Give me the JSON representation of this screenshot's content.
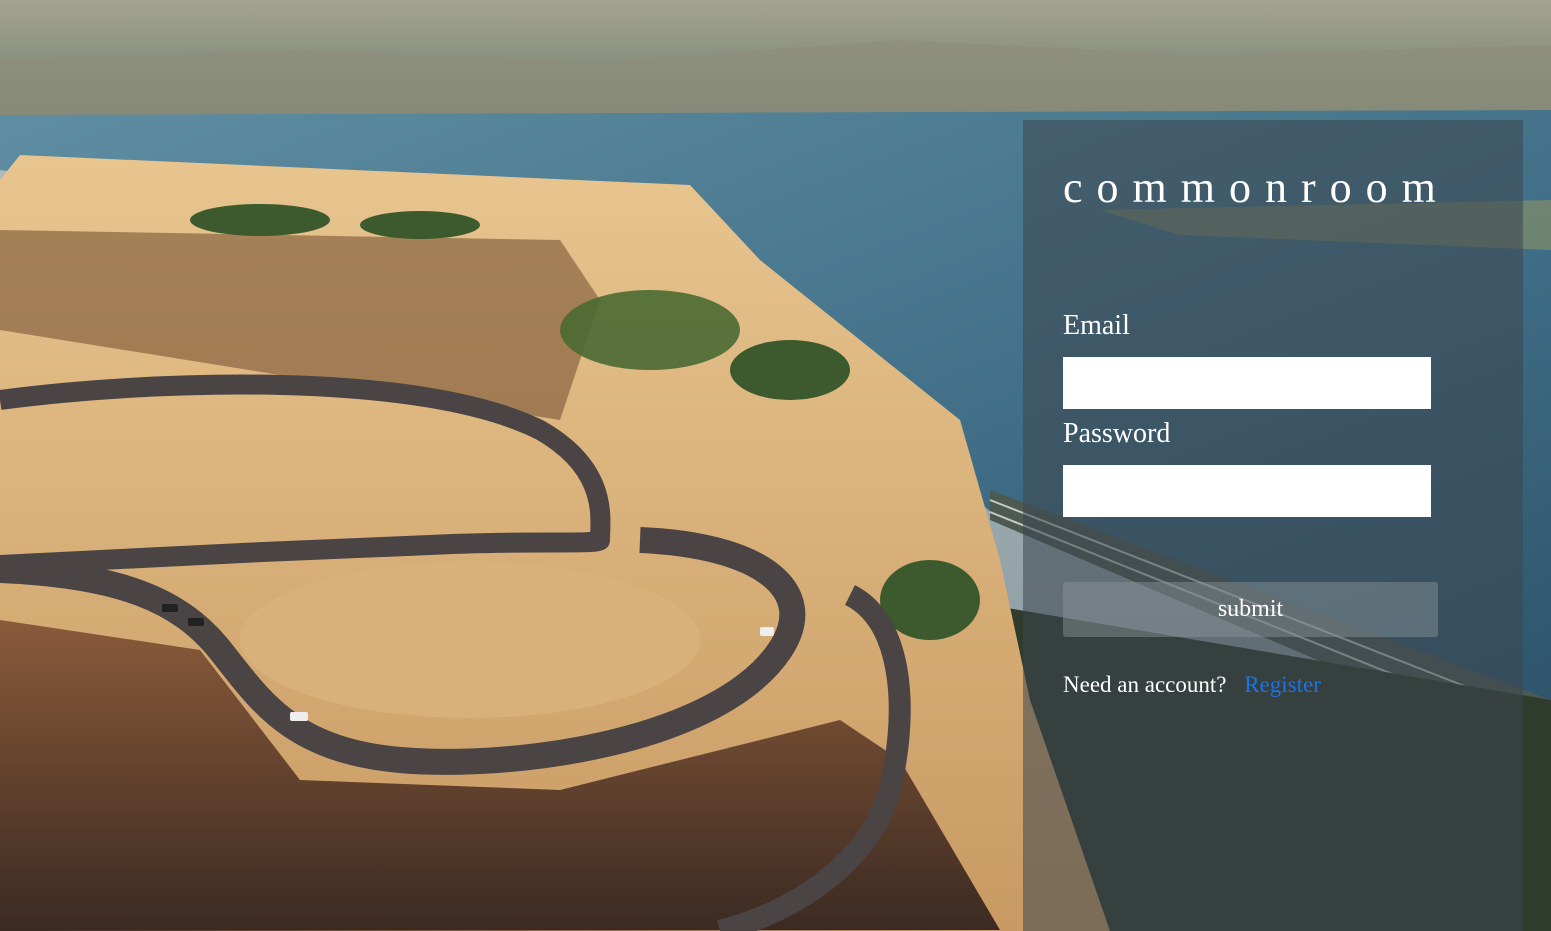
{
  "brand": {
    "name": "commonroom"
  },
  "login_form": {
    "email_label": "Email",
    "email_value": "",
    "password_label": "Password",
    "password_value": "",
    "submit_label": "submit",
    "account_prompt": "Need an account?",
    "register_link": "Register"
  },
  "colors": {
    "panel_overlay": "#3c464e",
    "link_blue": "#1a73e8",
    "text_white": "#ffffff"
  },
  "background": {
    "scene": "aerial view of a winding road on a cliff plateau above a river"
  }
}
